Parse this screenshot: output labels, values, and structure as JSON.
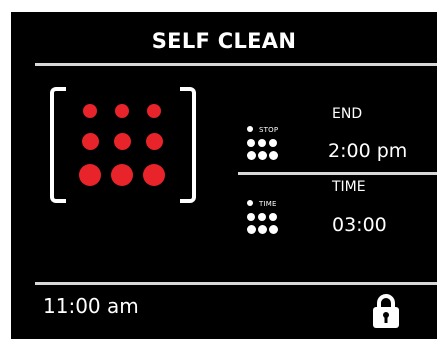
{
  "header": {
    "title": "SELF CLEAN"
  },
  "schedule": {
    "stop": {
      "icon_caption": "STOP",
      "label": "END",
      "value": "2:00 pm"
    },
    "time": {
      "icon_caption": "TIME",
      "label": "TIME",
      "value": "03:00"
    }
  },
  "status_bar": {
    "clock": "11:00 am",
    "lock_icon": "padlock-icon"
  },
  "colors": {
    "background": "#000000",
    "accent_red": "#e8232a",
    "text": "#ffffff",
    "rule": "#d8d8d8"
  },
  "icons": {
    "heating_indicator": "dot-grid-icon"
  }
}
